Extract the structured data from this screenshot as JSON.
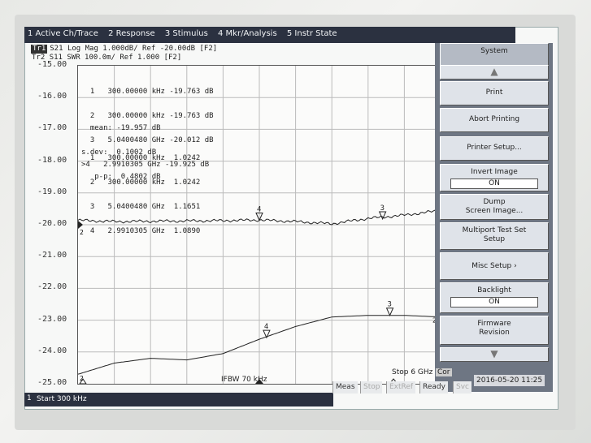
{
  "menu": [
    "1 Active Ch/Trace",
    "2 Response",
    "3 Stimulus",
    "4 Mkr/Analysis",
    "5 Instr State"
  ],
  "traces": {
    "tr1_badge": "Tr1",
    "tr1_text": "S21 Log Mag 1.000dB/ Ref -20.00dB [F2]",
    "tr2_label": "Tr2",
    "tr2_text": "S11  SWR 100.0m/ Ref 1.000 [F2]"
  },
  "y_axis_labels": [
    "-15.00",
    "-16.00",
    "-17.00",
    "-18.00",
    "-19.00",
    "-20.00",
    "-21.00",
    "-22.00",
    "-23.00",
    "-24.00",
    "-25.00"
  ],
  "marker_table_1": [
    "  1   300.00000 kHz -19.763 dB",
    "  2   300.00000 kHz -19.763 dB",
    "  3   5.0400480 GHz -20.012 dB",
    ">4   2.9910305 GHz -19.925 dB"
  ],
  "stats": [
    "  mean: -19.957 dB",
    "s.dev:  0.1002 dB",
    "   p-p:  0.4802 dB"
  ],
  "marker_table_2": [
    "  1   300.00000 kHz  1.0242",
    "  2   300.00000 kHz  1.0242",
    "  3   5.0400480 GHz  1.1651",
    "  4   2.9910305 GHz  1.0890"
  ],
  "trace_marker_labels": {
    "m1": "1",
    "m2": "2",
    "m3": "3",
    "m4": "4"
  },
  "softkeys": {
    "system": "System",
    "print": "Print",
    "abort_printing": "Abort Printing",
    "printer_setup": "Printer Setup...",
    "invert_image": "Invert Image",
    "invert_image_value": "ON",
    "dump_screen": "Dump",
    "dump_screen_2": "Screen Image...",
    "multiport": "Multiport Test Set",
    "multiport_2": "Setup",
    "misc_setup": "Misc Setup",
    "backlight": "Backlight",
    "backlight_value": "ON",
    "firmware": "Firmware",
    "firmware_2": "Revision"
  },
  "bottom": {
    "channel": "1",
    "start": "Start 300 kHz",
    "ifbw": "IFBW 70 kHz",
    "stop": "Stop 6 GHz",
    "cor": "Cor"
  },
  "status": [
    "Meas",
    "Stop",
    "ExtRef",
    "Ready",
    "Svc"
  ],
  "timestamp": "2016-05-20 11:25",
  "chart_data": {
    "type": "line",
    "title": "",
    "xlabel": "",
    "ylabel": "",
    "x_range_text": [
      "Start 300 kHz",
      "Stop 6 GHz"
    ],
    "ylim": [
      -25.0,
      -15.0
    ],
    "grid": true,
    "series": [
      {
        "name": "S21",
        "color": "#222222",
        "x": [
          0,
          0.1,
          0.2,
          0.3,
          0.4,
          0.5,
          0.6,
          0.7,
          0.8,
          0.9,
          1.0
        ],
        "y": [
          -19.86,
          -19.9,
          -19.89,
          -19.88,
          -19.87,
          -19.85,
          -19.9,
          -19.97,
          -19.8,
          -19.7,
          -19.55
        ]
      },
      {
        "name": "S11",
        "color": "#222222",
        "x": [
          0,
          0.1,
          0.2,
          0.3,
          0.4,
          0.5,
          0.6,
          0.7,
          0.8,
          0.9,
          1.0
        ],
        "y": [
          -24.7,
          -24.35,
          -24.2,
          -24.25,
          -24.05,
          -23.6,
          -23.2,
          -22.9,
          -22.85,
          -22.85,
          -22.9
        ]
      }
    ]
  }
}
